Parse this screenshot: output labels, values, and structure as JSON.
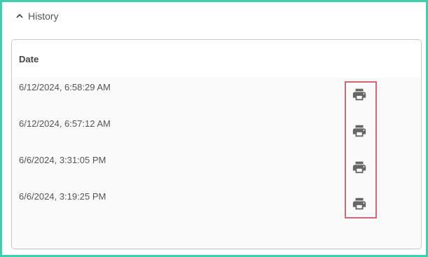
{
  "history": {
    "title": "History",
    "column_date": "Date",
    "rows": [
      {
        "date": "6/12/2024, 6:58:29 AM",
        "action_icon": "print-icon"
      },
      {
        "date": "6/12/2024, 6:57:12 AM",
        "action_icon": "print-icon"
      },
      {
        "date": "6/6/2024, 3:31:05 PM",
        "action_icon": "print-icon"
      },
      {
        "date": "6/6/2024, 3:19:25 PM",
        "action_icon": "print-icon"
      }
    ]
  },
  "colors": {
    "frame_border": "#3ecfae",
    "highlight_border": "#d06778",
    "icon": "#666666"
  }
}
